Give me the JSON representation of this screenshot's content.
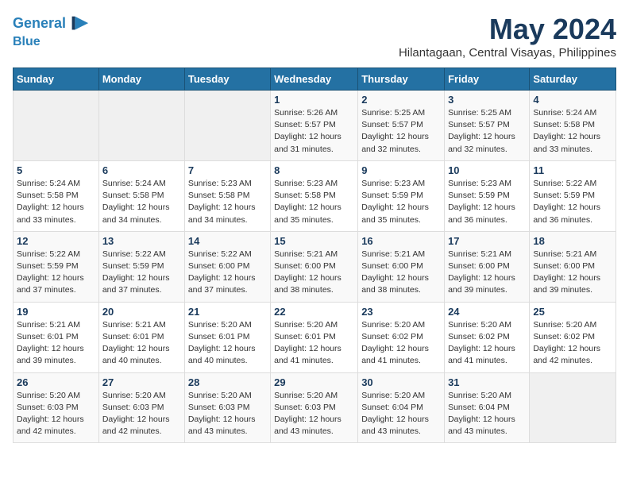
{
  "header": {
    "logo_line1": "General",
    "logo_line2": "Blue",
    "month_year": "May 2024",
    "location": "Hilantagaan, Central Visayas, Philippines"
  },
  "days_of_week": [
    "Sunday",
    "Monday",
    "Tuesday",
    "Wednesday",
    "Thursday",
    "Friday",
    "Saturday"
  ],
  "weeks": [
    [
      {
        "day": "",
        "info": ""
      },
      {
        "day": "",
        "info": ""
      },
      {
        "day": "",
        "info": ""
      },
      {
        "day": "1",
        "info": "Sunrise: 5:26 AM\nSunset: 5:57 PM\nDaylight: 12 hours and 31 minutes."
      },
      {
        "day": "2",
        "info": "Sunrise: 5:25 AM\nSunset: 5:57 PM\nDaylight: 12 hours and 32 minutes."
      },
      {
        "day": "3",
        "info": "Sunrise: 5:25 AM\nSunset: 5:57 PM\nDaylight: 12 hours and 32 minutes."
      },
      {
        "day": "4",
        "info": "Sunrise: 5:24 AM\nSunset: 5:58 PM\nDaylight: 12 hours and 33 minutes."
      }
    ],
    [
      {
        "day": "5",
        "info": "Sunrise: 5:24 AM\nSunset: 5:58 PM\nDaylight: 12 hours and 33 minutes."
      },
      {
        "day": "6",
        "info": "Sunrise: 5:24 AM\nSunset: 5:58 PM\nDaylight: 12 hours and 34 minutes."
      },
      {
        "day": "7",
        "info": "Sunrise: 5:23 AM\nSunset: 5:58 PM\nDaylight: 12 hours and 34 minutes."
      },
      {
        "day": "8",
        "info": "Sunrise: 5:23 AM\nSunset: 5:58 PM\nDaylight: 12 hours and 35 minutes."
      },
      {
        "day": "9",
        "info": "Sunrise: 5:23 AM\nSunset: 5:59 PM\nDaylight: 12 hours and 35 minutes."
      },
      {
        "day": "10",
        "info": "Sunrise: 5:23 AM\nSunset: 5:59 PM\nDaylight: 12 hours and 36 minutes."
      },
      {
        "day": "11",
        "info": "Sunrise: 5:22 AM\nSunset: 5:59 PM\nDaylight: 12 hours and 36 minutes."
      }
    ],
    [
      {
        "day": "12",
        "info": "Sunrise: 5:22 AM\nSunset: 5:59 PM\nDaylight: 12 hours and 37 minutes."
      },
      {
        "day": "13",
        "info": "Sunrise: 5:22 AM\nSunset: 5:59 PM\nDaylight: 12 hours and 37 minutes."
      },
      {
        "day": "14",
        "info": "Sunrise: 5:22 AM\nSunset: 6:00 PM\nDaylight: 12 hours and 37 minutes."
      },
      {
        "day": "15",
        "info": "Sunrise: 5:21 AM\nSunset: 6:00 PM\nDaylight: 12 hours and 38 minutes."
      },
      {
        "day": "16",
        "info": "Sunrise: 5:21 AM\nSunset: 6:00 PM\nDaylight: 12 hours and 38 minutes."
      },
      {
        "day": "17",
        "info": "Sunrise: 5:21 AM\nSunset: 6:00 PM\nDaylight: 12 hours and 39 minutes."
      },
      {
        "day": "18",
        "info": "Sunrise: 5:21 AM\nSunset: 6:00 PM\nDaylight: 12 hours and 39 minutes."
      }
    ],
    [
      {
        "day": "19",
        "info": "Sunrise: 5:21 AM\nSunset: 6:01 PM\nDaylight: 12 hours and 39 minutes."
      },
      {
        "day": "20",
        "info": "Sunrise: 5:21 AM\nSunset: 6:01 PM\nDaylight: 12 hours and 40 minutes."
      },
      {
        "day": "21",
        "info": "Sunrise: 5:20 AM\nSunset: 6:01 PM\nDaylight: 12 hours and 40 minutes."
      },
      {
        "day": "22",
        "info": "Sunrise: 5:20 AM\nSunset: 6:01 PM\nDaylight: 12 hours and 41 minutes."
      },
      {
        "day": "23",
        "info": "Sunrise: 5:20 AM\nSunset: 6:02 PM\nDaylight: 12 hours and 41 minutes."
      },
      {
        "day": "24",
        "info": "Sunrise: 5:20 AM\nSunset: 6:02 PM\nDaylight: 12 hours and 41 minutes."
      },
      {
        "day": "25",
        "info": "Sunrise: 5:20 AM\nSunset: 6:02 PM\nDaylight: 12 hours and 42 minutes."
      }
    ],
    [
      {
        "day": "26",
        "info": "Sunrise: 5:20 AM\nSunset: 6:03 PM\nDaylight: 12 hours and 42 minutes."
      },
      {
        "day": "27",
        "info": "Sunrise: 5:20 AM\nSunset: 6:03 PM\nDaylight: 12 hours and 42 minutes."
      },
      {
        "day": "28",
        "info": "Sunrise: 5:20 AM\nSunset: 6:03 PM\nDaylight: 12 hours and 43 minutes."
      },
      {
        "day": "29",
        "info": "Sunrise: 5:20 AM\nSunset: 6:03 PM\nDaylight: 12 hours and 43 minutes."
      },
      {
        "day": "30",
        "info": "Sunrise: 5:20 AM\nSunset: 6:04 PM\nDaylight: 12 hours and 43 minutes."
      },
      {
        "day": "31",
        "info": "Sunrise: 5:20 AM\nSunset: 6:04 PM\nDaylight: 12 hours and 43 minutes."
      },
      {
        "day": "",
        "info": ""
      }
    ]
  ]
}
